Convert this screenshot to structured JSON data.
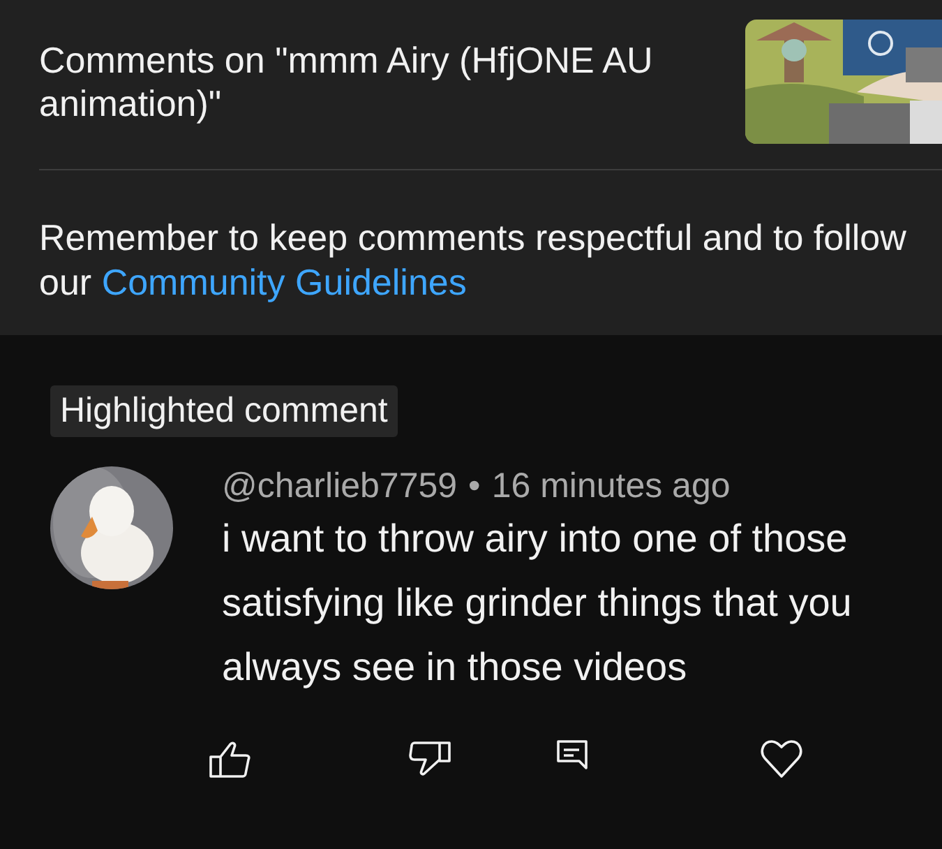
{
  "header": {
    "title": "Comments on \"mmm Airy (HfjONE AU animation)\""
  },
  "notice": {
    "text": "Remember to keep comments respectful and to follow",
    "prefix": "our",
    "link": "Community Guidelines"
  },
  "comment": {
    "badge": "Highlighted comment",
    "author": "@charlieb7759",
    "separator": "•",
    "time": "16 minutes ago",
    "text": "i want to throw airy into one of those satisfying like grinder things that you always see in those videos",
    "actions": [
      {
        "kind": "like"
      },
      {
        "kind": "dislike"
      },
      {
        "kind": "reply"
      },
      {
        "kind": "heart"
      }
    ]
  }
}
